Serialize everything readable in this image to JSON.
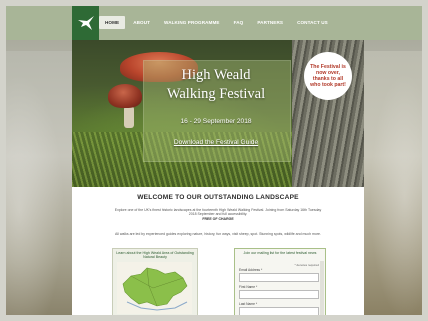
{
  "nav": {
    "items": [
      {
        "label": "HOME",
        "active": true
      },
      {
        "label": "ABOUT",
        "active": false
      },
      {
        "label": "WALKING PROGRAMME",
        "active": false
      },
      {
        "label": "FAQ",
        "active": false
      },
      {
        "label": "PARTNERS",
        "active": false
      },
      {
        "label": "CONTACT US",
        "active": false
      }
    ]
  },
  "hero": {
    "title_line1": "High Weald",
    "title_line2": "Walking Festival",
    "dates": "16 - 29 September 2018",
    "download_link": "Download the Festival Guide",
    "badge_text": "The Festival is now over, thanks to all who took part!"
  },
  "main": {
    "heading": "WELCOME TO OUR OUTSTANDING LANDSCAPE",
    "intro": "Explore one of the UK's finest historic landscapes at the fourteenth High Weald Walking Festival. Joining from Saturday 16th Tuesday 2018 September and full accessibility.",
    "intro_bold": "FREE OF CHARGE",
    "guides_text": "All walks are led by experienced guides exploring nature, history, fun ways, visit sheep, spot. Stunning spots, wildlife and much more.",
    "map_box_title": "Learn about the High Weald Area of Outstanding Natural Beauty",
    "form_title": "Join our mailing list for the latest festival news",
    "form_required": "* denotes required",
    "form_labels": [
      "Email Address *",
      "First Name *",
      "Last Name *"
    ]
  },
  "colors": {
    "logo_green": "#2e6a35",
    "nav_band": "#a8b597",
    "badge_text": "#b23a2a",
    "map_green": "#8bbf4a"
  }
}
